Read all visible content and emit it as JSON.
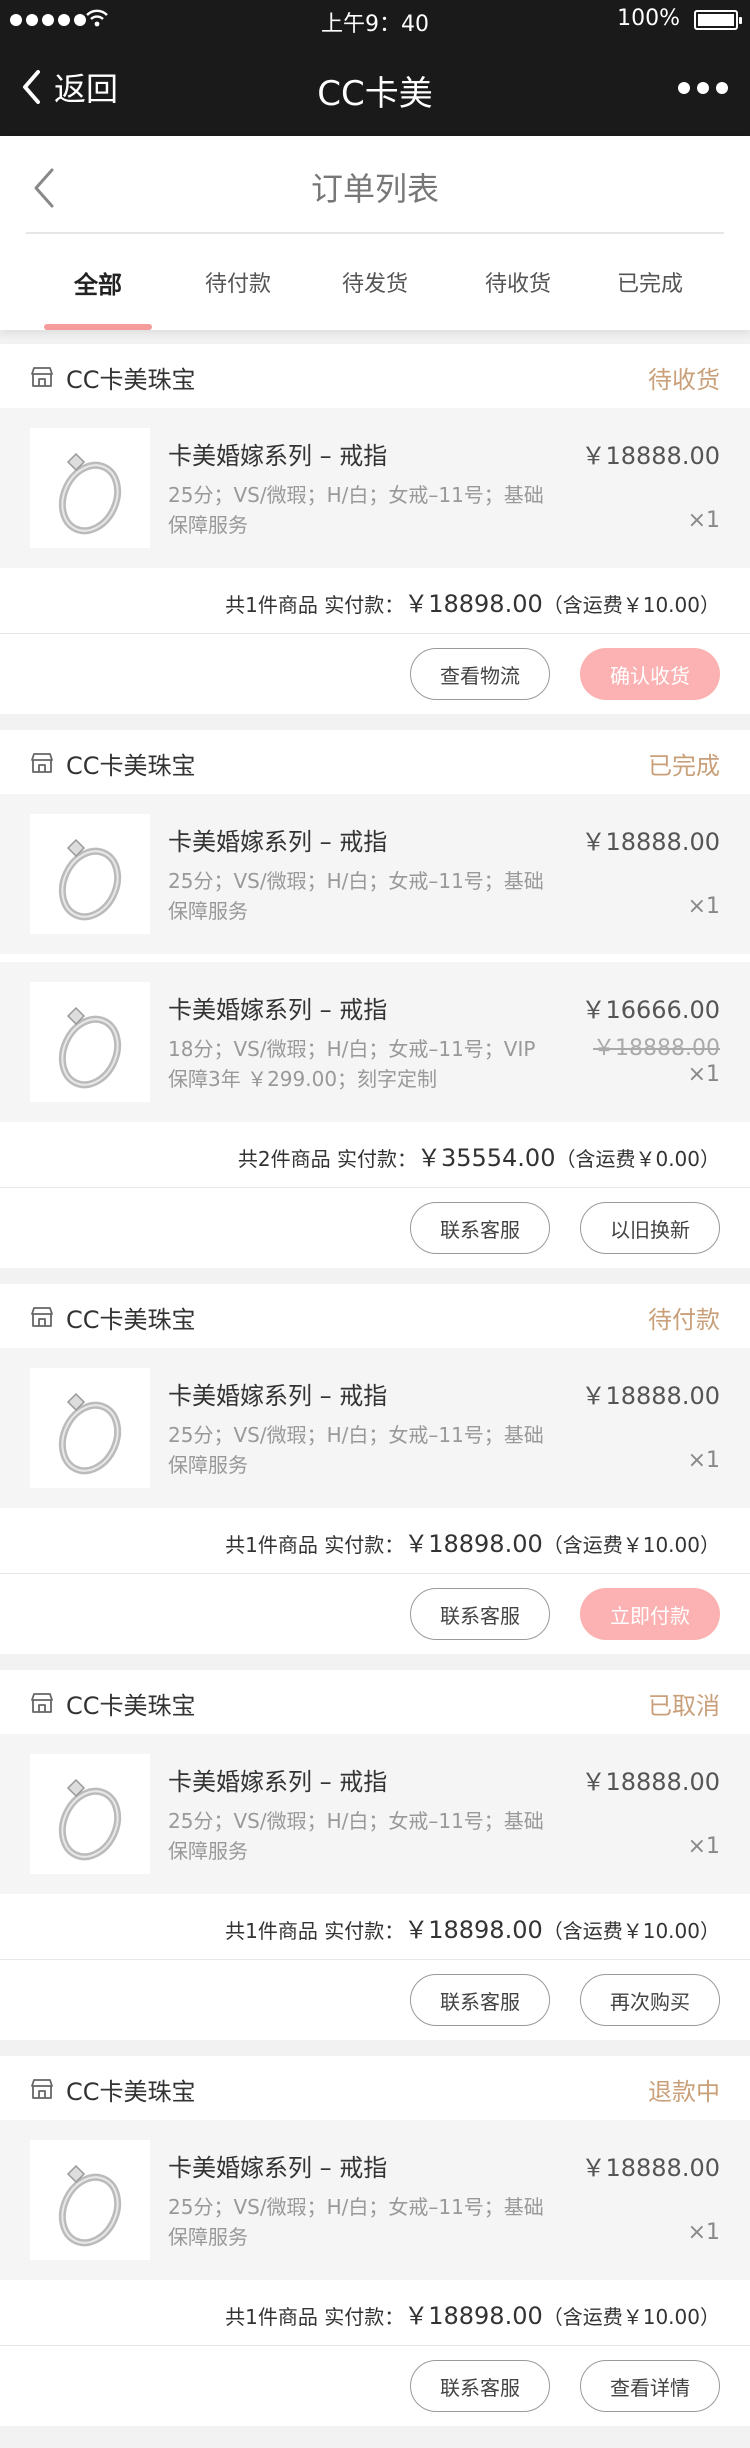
{
  "status_bar": {
    "time": "上午9：40",
    "battery": "100%"
  },
  "navbar": {
    "back_label": "返回",
    "title": "CC卡美"
  },
  "page": {
    "title": "订单列表",
    "tabs": [
      {
        "label": "全部",
        "active": true
      },
      {
        "label": "待付款"
      },
      {
        "label": "待发货"
      },
      {
        "label": "待收货"
      },
      {
        "label": "已完成"
      }
    ]
  },
  "orders": [
    {
      "store": "CC卡美珠宝",
      "status": "待收货",
      "items": [
        {
          "name": "卡美婚嫁系列 – 戒指",
          "spec": "25分；VS/微瑕；H/白；女戒–11号；基础保障服务",
          "price": "￥18888.00",
          "qty": "×1"
        }
      ],
      "summary_prefix": "共1件商品 实付款：",
      "summary_amount": "￥18898.00",
      "summary_suffix": "（含运费￥10.00）",
      "actions": [
        {
          "label": "查看物流",
          "style": "outline"
        },
        {
          "label": "确认收货",
          "style": "primary"
        }
      ]
    },
    {
      "store": "CC卡美珠宝",
      "status": "已完成",
      "items": [
        {
          "name": "卡美婚嫁系列 – 戒指",
          "spec": "25分；VS/微瑕；H/白；女戒–11号；基础保障服务",
          "price": "￥18888.00",
          "qty": "×1"
        },
        {
          "name": "卡美婚嫁系列 – 戒指",
          "spec": "18分；VS/微瑕；H/白；女戒–11号；VIP保障3年 ￥299.00；刻字定制",
          "price": "￥16666.00",
          "original_price": "￥18888.00",
          "qty": "×1"
        }
      ],
      "summary_prefix": "共2件商品 实付款：",
      "summary_amount": "￥35554.00",
      "summary_suffix": "（含运费￥0.00）",
      "actions": [
        {
          "label": "联系客服",
          "style": "outline"
        },
        {
          "label": "以旧换新",
          "style": "outline"
        }
      ]
    },
    {
      "store": "CC卡美珠宝",
      "status": "待付款",
      "items": [
        {
          "name": "卡美婚嫁系列 – 戒指",
          "spec": "25分；VS/微瑕；H/白；女戒–11号；基础保障服务",
          "price": "￥18888.00",
          "qty": "×1"
        }
      ],
      "summary_prefix": "共1件商品 实付款：",
      "summary_amount": "￥18898.00",
      "summary_suffix": "（含运费￥10.00）",
      "actions": [
        {
          "label": "联系客服",
          "style": "outline"
        },
        {
          "label": "立即付款",
          "style": "primary"
        }
      ]
    },
    {
      "store": "CC卡美珠宝",
      "status": "已取消",
      "items": [
        {
          "name": "卡美婚嫁系列 – 戒指",
          "spec": "25分；VS/微瑕；H/白；女戒–11号；基础保障服务",
          "price": "￥18888.00",
          "qty": "×1"
        }
      ],
      "summary_prefix": "共1件商品 实付款：",
      "summary_amount": "￥18898.00",
      "summary_suffix": "（含运费￥10.00）",
      "actions": [
        {
          "label": "联系客服",
          "style": "outline"
        },
        {
          "label": "再次购买",
          "style": "outline"
        }
      ]
    },
    {
      "store": "CC卡美珠宝",
      "status": "退款中",
      "items": [
        {
          "name": "卡美婚嫁系列 – 戒指",
          "spec": "25分；VS/微瑕；H/白；女戒–11号；基础保障服务",
          "price": "￥18888.00",
          "qty": "×1"
        }
      ],
      "summary_prefix": "共1件商品 实付款：",
      "summary_amount": "￥18898.00",
      "summary_suffix": "（含运费￥10.00）",
      "actions": [
        {
          "label": "联系客服",
          "style": "outline"
        },
        {
          "label": "查看详情",
          "style": "outline"
        }
      ]
    }
  ],
  "icons": {
    "back": "chevron-left-icon",
    "more": "more-dots-icon",
    "store": "store-icon",
    "product": "ring-icon"
  },
  "colors": {
    "nav_background": "#1a1a1a",
    "status_text": "#c9a07a",
    "primary_button": "#fcb2b2",
    "tab_indicator": "#f59b9b"
  }
}
